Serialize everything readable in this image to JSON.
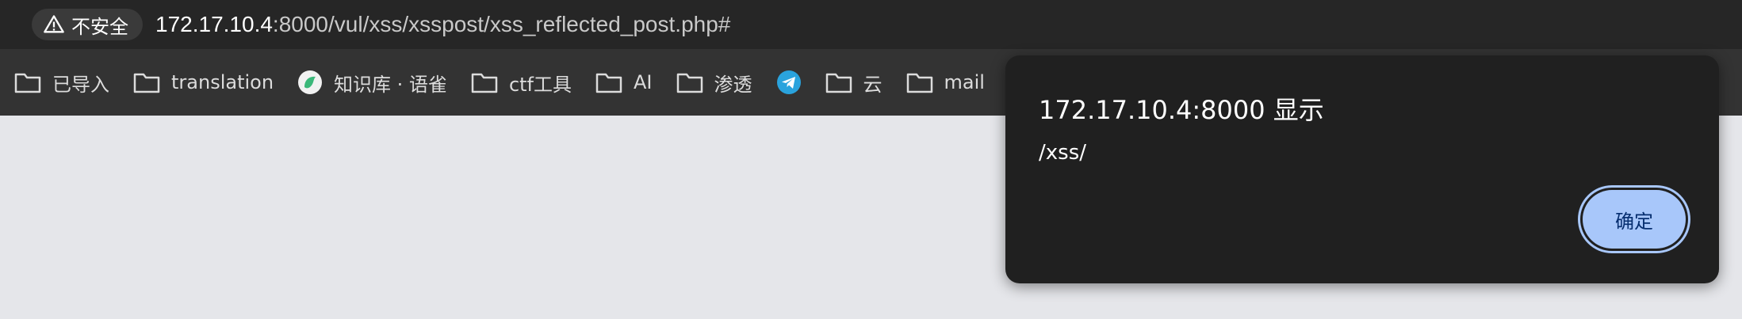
{
  "address_bar": {
    "security_label": "不安全",
    "url_host": "172.17.10.4",
    "url_rest": ":8000/vul/xss/xsspost/xss_reflected_post.php#"
  },
  "bookmarks": [
    {
      "icon": "folder-icon",
      "label": "已导入"
    },
    {
      "icon": "folder-icon",
      "label": "translation"
    },
    {
      "icon": "yuque-icon",
      "label": "知识库 · 语雀"
    },
    {
      "icon": "folder-icon",
      "label": "ctf工具"
    },
    {
      "icon": "folder-icon",
      "label": "AI"
    },
    {
      "icon": "folder-icon",
      "label": "渗透"
    },
    {
      "icon": "telegram-icon",
      "label": ""
    },
    {
      "icon": "folder-icon",
      "label": "云"
    },
    {
      "icon": "folder-icon",
      "label": "mail"
    }
  ],
  "dialog": {
    "title": "172.17.10.4:8000 显示",
    "message": "/xss/",
    "ok_label": "确定"
  },
  "colors": {
    "toolbar": "#262626",
    "bookmarks_bar": "#333333",
    "page_bg": "#e5e6ea",
    "dialog_bg": "#202020",
    "button_bg": "#a8c7fa",
    "telegram": "#2aa3dd",
    "yuque": "#3bb87a"
  }
}
